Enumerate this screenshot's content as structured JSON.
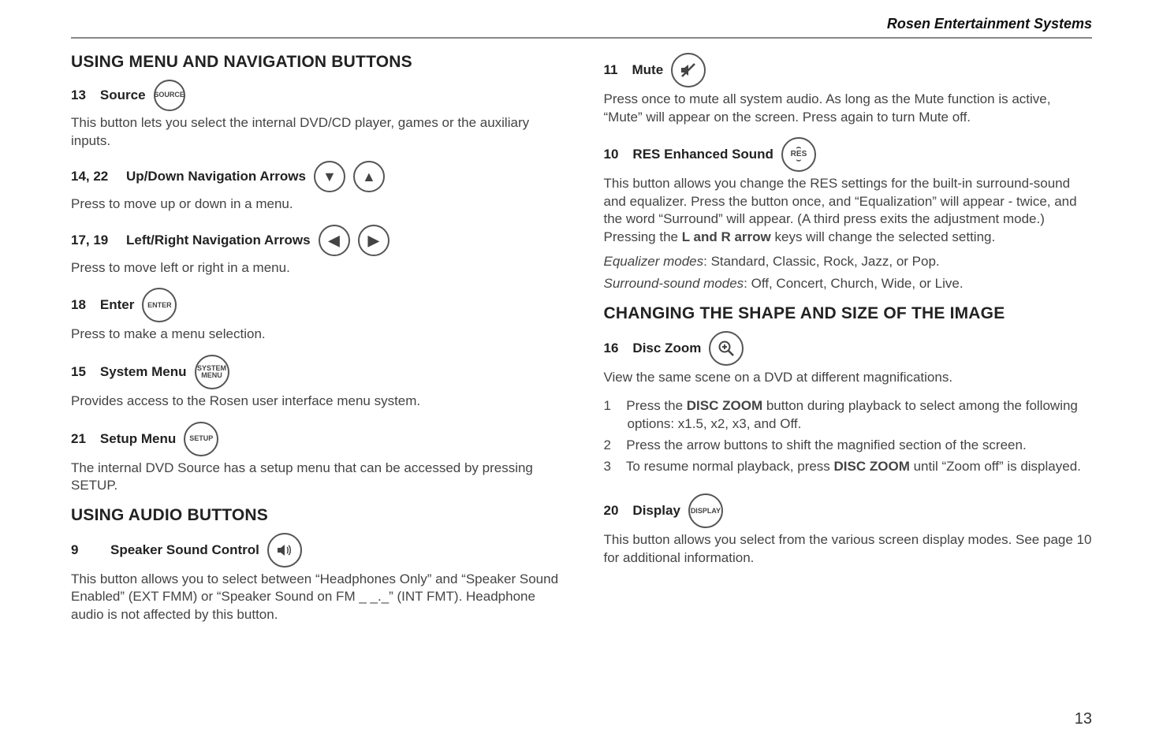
{
  "brand": "Rosen Entertainment Systems",
  "page_number": "13",
  "left": {
    "heading1": "USING MENU AND NAVIGATION BUTTONS",
    "source": {
      "num": "13",
      "title": "Source",
      "icon_label": "SOURCE",
      "body": "This button lets you select the internal DVD/CD player, games or the auxiliary inputs."
    },
    "updown": {
      "num": "14, 22",
      "title": "Up/Down Navigation Arrows",
      "body": "Press to move up or down in a menu."
    },
    "leftright": {
      "num": "17, 19",
      "title": "Left/Right Navigation Arrows",
      "body": "Press to move left or right in a menu."
    },
    "enter": {
      "num": "18",
      "title": "Enter",
      "icon_label": "ENTER",
      "body": "Press to make a menu selection."
    },
    "sysmenu": {
      "num": "15",
      "title": "System Menu",
      "icon_label_top": "SYSTEM",
      "icon_label_bot": "MENU",
      "body": "Provides access to the Rosen user interface menu system."
    },
    "setup": {
      "num": "21",
      "title": "Setup Menu",
      "icon_label": "SETUP",
      "body": "The internal DVD Source has a setup menu that can be accessed by pressing SETUP."
    },
    "heading2": "USING AUDIO BUTTONS",
    "speaker": {
      "num": "9",
      "title": "Speaker Sound Control",
      "body": "This button allows you to select between “Headphones Only” and “Speaker Sound Enabled” (EXT FMM) or “Speaker Sound on FM _ _._” (INT FMT). Headphone audio is not affected by this button."
    }
  },
  "right": {
    "mute": {
      "num": "11",
      "title": "Mute",
      "body": "Press once to mute all system audio. As long as the Mute function is active, “Mute” will appear on the screen. Press again to turn Mute off."
    },
    "res": {
      "num": "10",
      "title": "RES Enhanced Sound",
      "icon_label": "RES",
      "body_pre": "This button allows you change the RES settings for the built-in surround-sound and equalizer. Press the button once, and “Equalization” will appear - twice, and the word “Surround” will appear. (A third press exits the adjustment mode.) Pressing the ",
      "body_bold": "L and R arrow",
      "body_post": " keys will change the selected setting.",
      "eq_label": "Equalizer modes",
      "eq_values": ": Standard, Classic, Rock, Jazz, or Pop.",
      "ss_label": "Surround-sound modes",
      "ss_values": ": Off, Concert, Church, Wide, or Live."
    },
    "heading2": "CHANGING THE SHAPE AND SIZE OF THE IMAGE",
    "zoom": {
      "num": "16",
      "title": "Disc Zoom",
      "body": "View the same scene on a DVD at different magnifications.",
      "step1_pre": "Press the ",
      "step1_bold": "DISC ZOOM",
      "step1_post": " button during playback to select among the following options: x1.5, x2, x3, and Off.",
      "step2": "Press the arrow buttons to shift the magnified section of the screen.",
      "step3_pre": "To resume normal playback, press ",
      "step3_bold": "DISC ZOOM",
      "step3_post": " until “Zoom off” is displayed."
    },
    "display": {
      "num": "20",
      "title": "Display",
      "icon_label": "DISPLAY",
      "body": "This button allows you select from the various screen display modes. See page 10 for additional information."
    }
  }
}
